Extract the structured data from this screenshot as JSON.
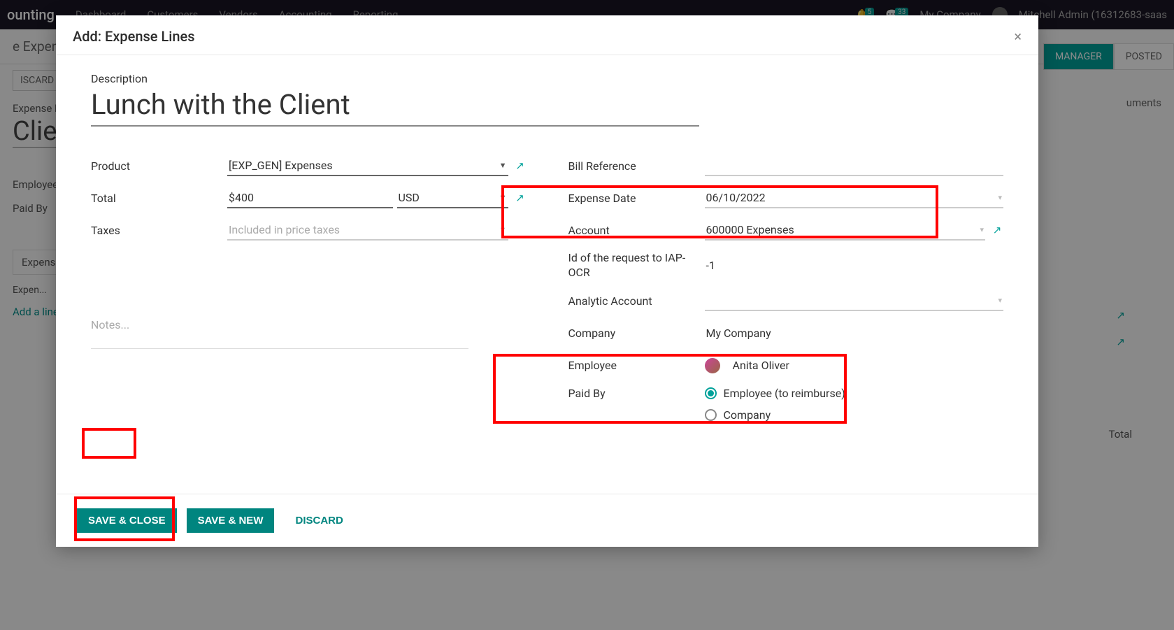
{
  "bg": {
    "brand": "ounting",
    "menus": [
      "Dashboard",
      "Customers",
      "Vendors",
      "Accounting",
      "Reporting"
    ],
    "badge1": "5",
    "badge2": "33",
    "company_menu": "My Company",
    "user": "Mitchell Admin (16312683-saas",
    "breadcrumb": "e Expens",
    "discard": "ISCARD",
    "manager": "MANAGER",
    "posted": "POSTED",
    "documents": "uments",
    "rep": "Expense R",
    "big": "Clie",
    "emp": "Employee",
    "paidby": "Paid By",
    "exp_tab": "Expens",
    "col": "Expen...",
    "addline": "Add a line",
    "total_col": "Total"
  },
  "modal": {
    "title": "Add: Expense Lines",
    "close": "×",
    "desc_label": "Description",
    "desc_value": "Lunch with the Client",
    "left": {
      "product_label": "Product",
      "product_value": "[EXP_GEN] Expenses",
      "total_label": "Total",
      "total_amount": "$400",
      "total_currency": "USD",
      "taxes_label": "Taxes",
      "taxes_placeholder": "Included in price taxes"
    },
    "right": {
      "bill_ref": "Bill Reference",
      "date_label": "Expense Date",
      "date_value": "06/10/2022",
      "account_label": "Account",
      "account_value": "600000 Expenses",
      "iap_label": "Id of the request to IAP-OCR",
      "iap_value": "-1",
      "analytic_label": "Analytic Account",
      "company_label": "Company",
      "company_value": "My Company",
      "employee_label": "Employee",
      "employee_value": "Anita Oliver",
      "paidby_label": "Paid By",
      "paidby_opt1": "Employee (to reimburse)",
      "paidby_opt2": "Company"
    },
    "notes_placeholder": "Notes...",
    "buttons": {
      "save_close": "SAVE & CLOSE",
      "save_new": "SAVE & NEW",
      "discard": "DISCARD"
    }
  }
}
